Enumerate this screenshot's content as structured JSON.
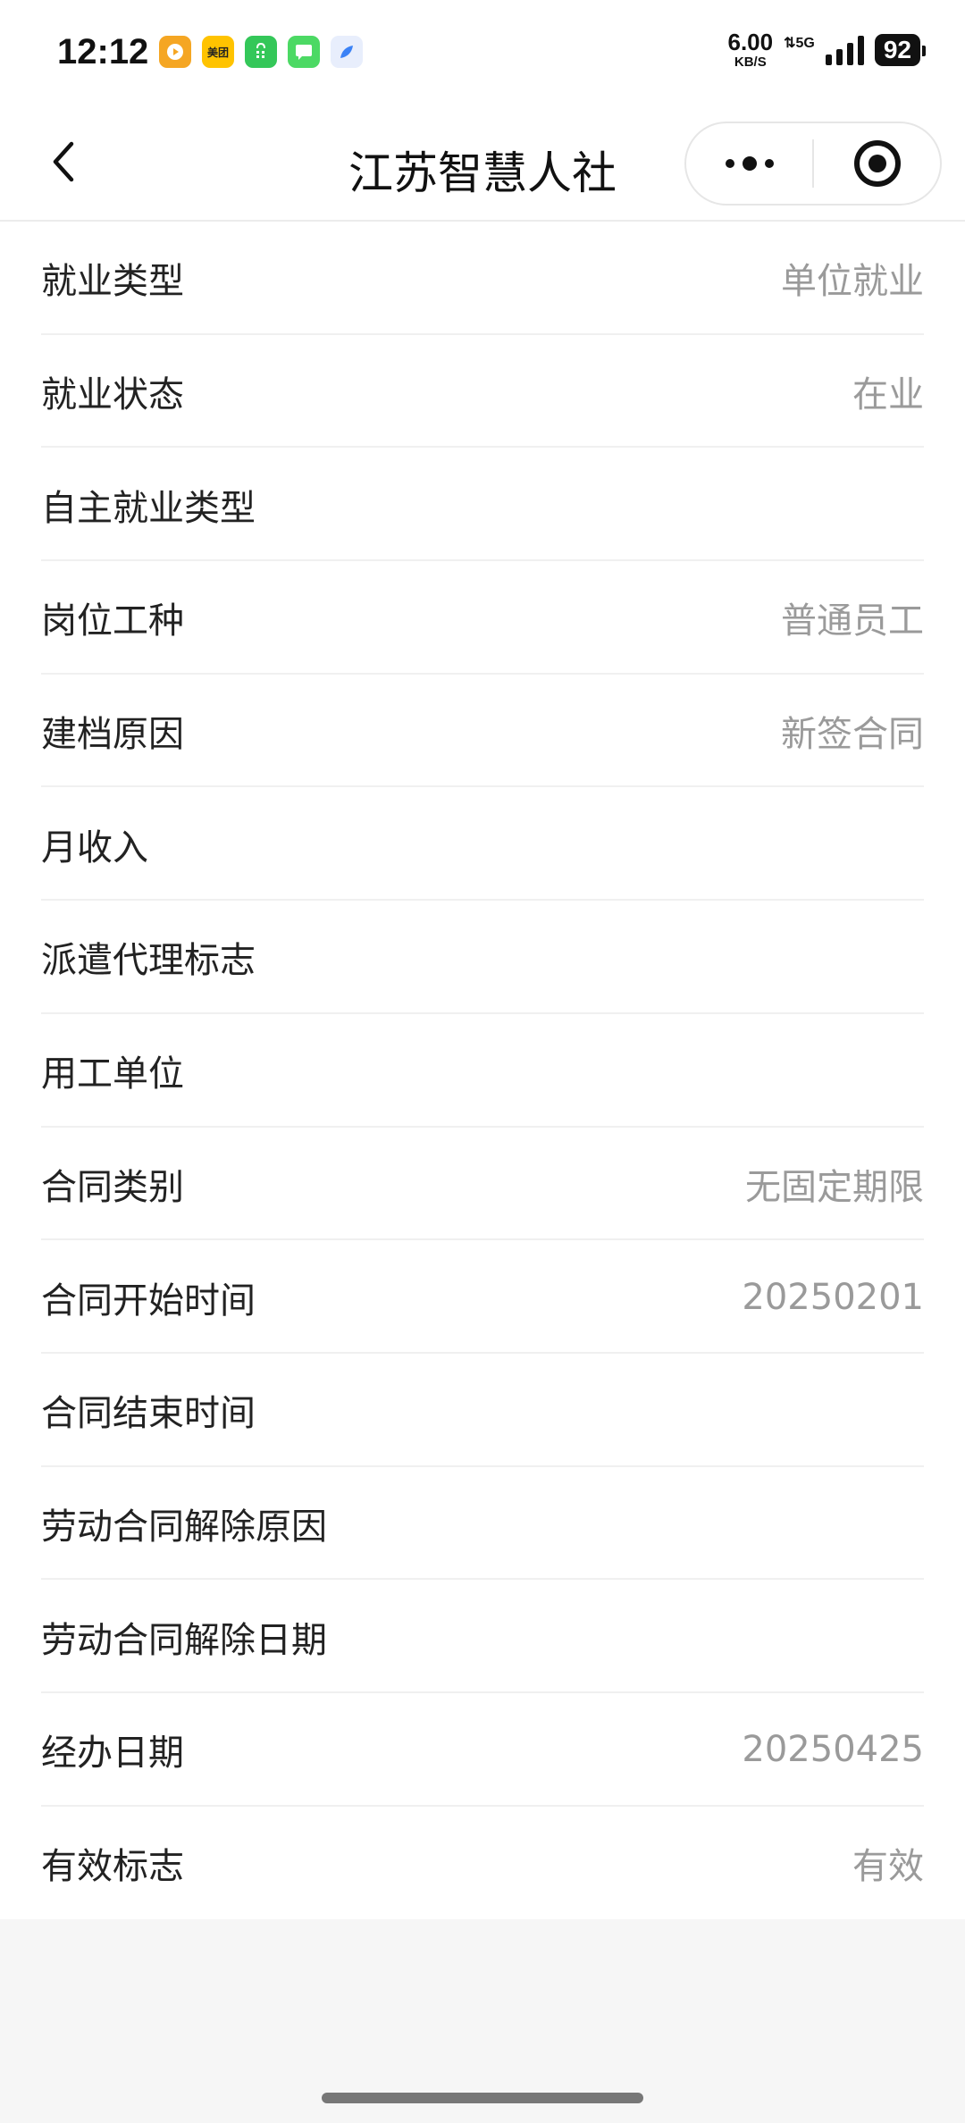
{
  "status_bar": {
    "time": "12:12",
    "net_speed": "6.00",
    "net_speed_unit": "KB/S",
    "net_type": "5G",
    "battery": "92",
    "app_icons": [
      {
        "name": "video-app-icon",
        "color": "#f5a623"
      },
      {
        "name": "meituan-app-icon",
        "color": "#ffc300",
        "text": "美团"
      },
      {
        "name": "shopping-app-icon",
        "color": "#34c759"
      },
      {
        "name": "message-app-icon",
        "color": "#4cd964"
      },
      {
        "name": "browser-app-icon",
        "color": "#3b82f6"
      }
    ]
  },
  "nav": {
    "title": "江苏智慧人社"
  },
  "fields": [
    {
      "label": "就业类型",
      "value": "单位就业"
    },
    {
      "label": "就业状态",
      "value": "在业"
    },
    {
      "label": "自主就业类型",
      "value": ""
    },
    {
      "label": "岗位工种",
      "value": "普通员工"
    },
    {
      "label": "建档原因",
      "value": "新签合同"
    },
    {
      "label": "月收入",
      "value": ""
    },
    {
      "label": "派遣代理标志",
      "value": ""
    },
    {
      "label": "用工单位",
      "value": ""
    },
    {
      "label": "合同类别",
      "value": "无固定期限"
    },
    {
      "label": "合同开始时间",
      "value": "20250201"
    },
    {
      "label": "合同结束时间",
      "value": ""
    },
    {
      "label": "劳动合同解除原因",
      "value": ""
    },
    {
      "label": "劳动合同解除日期",
      "value": ""
    },
    {
      "label": "经办日期",
      "value": "20250425"
    },
    {
      "label": "有效标志",
      "value": "有效"
    }
  ]
}
